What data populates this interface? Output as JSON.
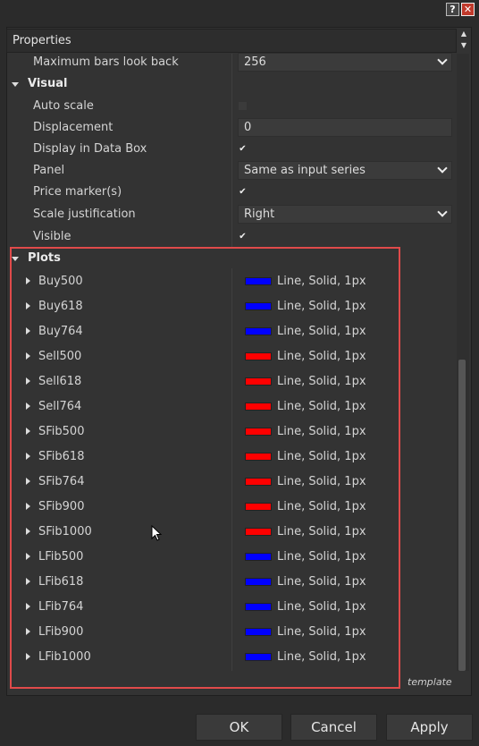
{
  "titlebar": {
    "help_glyph": "?",
    "close_glyph": "✕"
  },
  "panel_title": "Properties",
  "maximum_bars": {
    "label": "Maximum bars look back",
    "value": "256"
  },
  "visual": {
    "title": "Visual",
    "auto_scale": {
      "label": "Auto scale",
      "checked": false
    },
    "displacement": {
      "label": "Displacement",
      "value": "0"
    },
    "display_in_data_box": {
      "label": "Display in Data Box",
      "checked": true
    },
    "panel": {
      "label": "Panel",
      "value": "Same as input series"
    },
    "price_markers": {
      "label": "Price marker(s)",
      "checked": true
    },
    "scale_justification": {
      "label": "Scale justification",
      "value": "Right"
    },
    "visible": {
      "label": "Visible",
      "checked": true
    }
  },
  "plots": {
    "title": "Plots",
    "items": [
      {
        "name": "Buy500",
        "color": "#0000ff",
        "desc": "Line, Solid, 1px"
      },
      {
        "name": "Buy618",
        "color": "#0000ff",
        "desc": "Line, Solid, 1px"
      },
      {
        "name": "Buy764",
        "color": "#0000ff",
        "desc": "Line, Solid, 1px"
      },
      {
        "name": "Sell500",
        "color": "#ff0000",
        "desc": "Line, Solid, 1px"
      },
      {
        "name": "Sell618",
        "color": "#ff0000",
        "desc": "Line, Solid, 1px"
      },
      {
        "name": "Sell764",
        "color": "#ff0000",
        "desc": "Line, Solid, 1px"
      },
      {
        "name": "SFib500",
        "color": "#ff0000",
        "desc": "Line, Solid, 1px"
      },
      {
        "name": "SFib618",
        "color": "#ff0000",
        "desc": "Line, Solid, 1px"
      },
      {
        "name": "SFib764",
        "color": "#ff0000",
        "desc": "Line, Solid, 1px"
      },
      {
        "name": "SFib900",
        "color": "#ff0000",
        "desc": "Line, Solid, 1px"
      },
      {
        "name": "SFib1000",
        "color": "#ff0000",
        "desc": "Line, Solid, 1px"
      },
      {
        "name": "LFib500",
        "color": "#0000ff",
        "desc": "Line, Solid, 1px"
      },
      {
        "name": "LFib618",
        "color": "#0000ff",
        "desc": "Line, Solid, 1px"
      },
      {
        "name": "LFib764",
        "color": "#0000ff",
        "desc": "Line, Solid, 1px"
      },
      {
        "name": "LFib900",
        "color": "#0000ff",
        "desc": "Line, Solid, 1px"
      },
      {
        "name": "LFib1000",
        "color": "#0000ff",
        "desc": "Line, Solid, 1px"
      }
    ]
  },
  "template_link": "template",
  "buttons": {
    "ok": "OK",
    "cancel": "Cancel",
    "apply": "Apply"
  },
  "highlight_color": "#e04a4a"
}
